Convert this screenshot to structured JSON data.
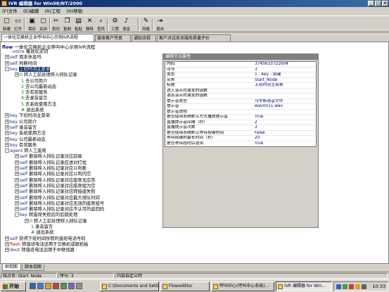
{
  "window": {
    "title": "IVR 编辑器 for Win98/NT/2000"
  },
  "menu": [
    "(F)文件",
    "(E)编辑",
    "(R)工程",
    "(H)帮助"
  ],
  "toolbar": [
    {
      "label": "新建",
      "icon": "new-file-icon",
      "glyph": "□"
    },
    {
      "label": "打开",
      "icon": "open-folder-icon",
      "glyph": "▭"
    },
    {
      "label": "保存",
      "icon": "save-icon",
      "glyph": "▣"
    },
    {
      "label": "关闭",
      "icon": "close-icon",
      "glyph": "▢"
    },
    {
      "label": "剪切",
      "icon": "cut-icon",
      "glyph": "✂"
    },
    {
      "label": "复制",
      "icon": "copy-icon",
      "glyph": "❐"
    },
    {
      "label": "粘贴",
      "icon": "paste-icon",
      "glyph": "▤"
    },
    {
      "label": "删除",
      "icon": "delete-icon",
      "glyph": "✕"
    },
    {
      "label": "查找",
      "icon": "find-icon",
      "glyph": "⌕"
    },
    {
      "label": "工程",
      "icon": "project-icon",
      "glyph": "⚙"
    },
    {
      "label": "语音",
      "icon": "voice-icon",
      "glyph": "♪"
    },
    {
      "label": "风格",
      "icon": "style-icon",
      "glyph": "✎"
    },
    {
      "label": "退出",
      "icon": "exit-icon",
      "glyph": "⇥"
    }
  ],
  "tabs": [
    "一体化交换机企业呼叫中心示例IVR流程",
    "接收客户传真",
    "通知流程",
    "客户对话务员服务质量评价"
  ],
  "flow": {
    "header_kw": "flow",
    "header_text": "一体化交换机企业呼叫中心示例IVR流程",
    "rows": [
      {
        "indent": 0,
        "box": "",
        "kw": "-voice",
        "kw_red": false,
        "num": "",
        "text": "播放欢迎词",
        "sel": false
      },
      {
        "indent": 0,
        "box": "+",
        "kw": "self",
        "kw_red": false,
        "num": "",
        "text": "周末休息吗",
        "sel": false
      },
      {
        "indent": 0,
        "box": "+",
        "kw": "self",
        "kw_red": false,
        "num": "",
        "text": "判断时间",
        "sel": false
      },
      {
        "indent": 0,
        "box": "-",
        "kw": "key",
        "kw_red": false,
        "num": "",
        "text": "上班时间主菜单",
        "sel": true
      },
      {
        "indent": 1,
        "box": "+",
        "kw": "",
        "kw_red": false,
        "num": "0",
        "text": "转人工前处理呼入排队记录",
        "sel": false
      },
      {
        "indent": 1,
        "box": "",
        "kw": "",
        "kw_red": false,
        "num": "1",
        "text": "去公司简介",
        "sel": false
      },
      {
        "indent": 1,
        "box": "",
        "kw": "",
        "kw_red": false,
        "num": "2",
        "text": "去公司最新动态",
        "sel": false
      },
      {
        "indent": 1,
        "box": "",
        "kw": "",
        "kw_red": false,
        "num": "3",
        "text": "去有奖服务",
        "sel": false
      },
      {
        "indent": 1,
        "box": "",
        "kw": "",
        "kw_red": false,
        "num": "4",
        "text": "去录音留言",
        "sel": false
      },
      {
        "indent": 1,
        "box": "",
        "kw": "",
        "kw_red": false,
        "num": "5",
        "text": "去系统使用方法",
        "sel": false
      },
      {
        "indent": 1,
        "box": "",
        "kw": "",
        "kw_red": false,
        "num": "#",
        "text": "退出系统",
        "sel": false
      },
      {
        "indent": 0,
        "box": "+",
        "kw": "key",
        "kw_red": false,
        "num": "",
        "text": "下班时间主菜单",
        "sel": false
      },
      {
        "indent": 0,
        "box": "+",
        "kw": "key",
        "kw_red": false,
        "num": "",
        "text": "公司简介",
        "sel": false
      },
      {
        "indent": 0,
        "box": "+",
        "kw": "self",
        "kw_red": false,
        "num": "",
        "text": "录音留言",
        "sel": false
      },
      {
        "indent": 0,
        "box": "+",
        "kw": "key",
        "kw_red": false,
        "num": "",
        "text": "系统使用方法",
        "sel": false
      },
      {
        "indent": 0,
        "box": "+",
        "kw": "key",
        "kw_red": false,
        "num": "",
        "text": "公司最新动态",
        "sel": false
      },
      {
        "indent": 0,
        "box": "+",
        "kw": "key",
        "kw_red": false,
        "num": "",
        "text": "有奖服务",
        "sel": false
      },
      {
        "indent": 0,
        "box": "-",
        "kw": "agent",
        "kw_red": false,
        "num": "",
        "text": "转人工座席",
        "sel": false
      },
      {
        "indent": 1,
        "box": "+",
        "kw": "self",
        "kw_red": false,
        "num": "",
        "text": "删除呼入排队记录对应前级",
        "sel": false
      },
      {
        "indent": 1,
        "box": "+",
        "kw": "self",
        "kw_red": false,
        "num": "",
        "text": "删除呼入排队记录应进对打扰",
        "sel": false
      },
      {
        "indent": 1,
        "box": "+",
        "kw": "self",
        "kw_red": false,
        "num": "",
        "text": "删除呼入排队记录对应以判断",
        "sel": false
      },
      {
        "indent": 1,
        "box": "+",
        "kw": "self",
        "kw_red": false,
        "num": "",
        "text": "删除呼入排队记录对应以判内空",
        "sel": false
      },
      {
        "indent": 1,
        "box": "+",
        "kw": "self",
        "kw_red": false,
        "num": "",
        "text": "删除呼入排队记录对应座席无应答",
        "sel": false
      },
      {
        "indent": 1,
        "box": "+",
        "kw": "self",
        "kw_red": false,
        "num": "",
        "text": "删除呼入排队记录对应座席组为空",
        "sel": false
      },
      {
        "indent": 1,
        "box": "+",
        "kw": "self",
        "kw_red": false,
        "num": "",
        "text": "删除呼入排队记录对应转接座失败",
        "sel": false
      },
      {
        "indent": 1,
        "box": "+",
        "kw": "self",
        "kw_red": false,
        "num": "",
        "text": "删除呼入排队记录对应最大排队时间",
        "sel": false
      },
      {
        "indent": 1,
        "box": "+",
        "kw": "self",
        "kw_red": false,
        "num": "",
        "text": "删除呼入排队记录对应无效的座席组号",
        "sel": false
      },
      {
        "indent": 1,
        "box": "+",
        "kw": "self",
        "kw_red": false,
        "num": "",
        "text": "删除呼入排队记录对应不认可的返回码",
        "sel": false
      },
      {
        "indent": 1,
        "box": "-",
        "kw": "key",
        "kw_red": false,
        "num": "",
        "text": "转座席失败后的后期处理",
        "sel": false
      },
      {
        "indent": 2,
        "box": "+",
        "kw": "",
        "kw_red": false,
        "num": "0",
        "text": "转人工前处理呼入排队记录",
        "sel": false
      },
      {
        "indent": 2,
        "box": "",
        "kw": "",
        "kw_red": false,
        "num": "1",
        "text": "录音留言",
        "sel": false
      },
      {
        "indent": 2,
        "box": "",
        "kw": "",
        "kw_red": false,
        "num": "#",
        "text": "退出系统",
        "sel": false
      },
      {
        "indent": 0,
        "box": "+",
        "kw": "self",
        "kw_red": false,
        "num": "",
        "text": "获得下班时间所转的值班电话号码",
        "sel": false
      },
      {
        "indent": 0,
        "box": "+",
        "kw": "flash",
        "kw_red": true,
        "num": "",
        "text": "转值班电话适用于交换机或联机板",
        "sel": false
      },
      {
        "indent": 0,
        "box": "+",
        "kw": "dout",
        "kw_red": false,
        "num": "",
        "text": "转值班电话适用于中继线路",
        "sel": false
      }
    ]
  },
  "props": {
    "title": "编辑节点属性",
    "rows": [
      {
        "k": "内码",
        "v": "3745633721604"
      },
      {
        "k": "序号",
        "v": "3"
      },
      {
        "k": "类型",
        "v": "1 - Key - 按键"
      },
      {
        "k": "名称",
        "v": "Start_Node"
      },
      {
        "k": "标题",
        "v": "上班时间主菜单"
      },
      {
        "k": "进入该点时激发的函数",
        "v": ""
      },
      {
        "k": "退出该点时激发的函数",
        "v": ""
      },
      {
        "k": "提示音类型",
        "v": "可中断语音文件"
      },
      {
        "k": "提示音",
        "v": "wav0011.wav"
      },
      {
        "k": "提示音进程",
        "v": ""
      },
      {
        "k": "是否使用系统默认方式播放提示音",
        "v": "True"
      },
      {
        "k": "直播提示音间隔（秒）",
        "v": "2"
      },
      {
        "k": "直播提示音次数",
        "v": "3"
      },
      {
        "k": "是否使用系统默认等待按键时间",
        "v": "False"
      },
      {
        "k": "等待按键的最长时间（秒）",
        "v": "20"
      },
      {
        "k": "是否等待超时后退出",
        "v": "True"
      }
    ]
  },
  "bottom_tabs": [
    "树视图",
    "脚本视图"
  ],
  "status": [
    "结点名: Start_Node",
    "序号: 3",
    "内容自定义吧"
  ],
  "taskbar": {
    "start": "开始",
    "buttons": [
      "C:\\Documents and Settin...",
      "Flowedittor",
      "呼叫中心(呼叫中心系统)...",
      "IVR 编辑器 for Win..."
    ],
    "active_index": 3,
    "clock": "10:33"
  }
}
